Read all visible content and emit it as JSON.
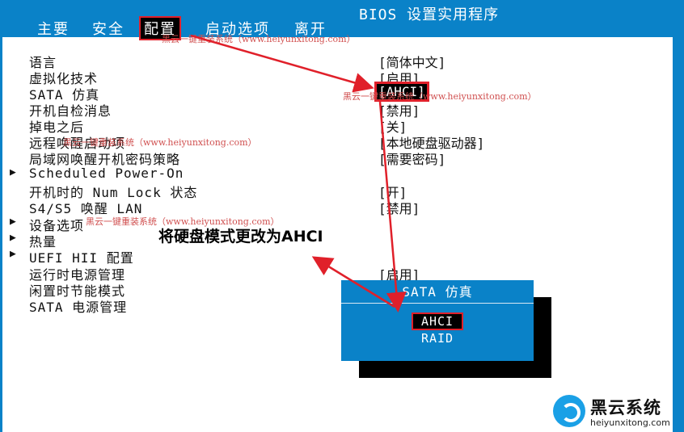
{
  "header": {
    "title": "BIOS 设置实用程序",
    "tabs": [
      {
        "label": "主要"
      },
      {
        "label": "安全"
      },
      {
        "label": "配置",
        "active": true
      },
      {
        "label": "启动选项"
      },
      {
        "label": "离开"
      }
    ]
  },
  "settings": [
    {
      "label": "语言",
      "value": "[简体中文]",
      "arrow": ""
    },
    {
      "label": "虚拟化技术",
      "value": "[启用]",
      "arrow": ""
    },
    {
      "label": "SATA 仿真",
      "value": "[AHCI]",
      "arrow": "",
      "highlight": true
    },
    {
      "label": "开机自检消息",
      "value": "[禁用]",
      "arrow": ""
    },
    {
      "label": "掉电之后",
      "value": "[关]",
      "arrow": ""
    },
    {
      "label": "远程唤醒启动项",
      "value": "[本地硬盘驱动器]",
      "arrow": ""
    },
    {
      "label": "局域网唤醒开机密码策略",
      "value": "[需要密码]",
      "arrow": ""
    },
    {
      "label": "Scheduled Power-On",
      "value": "",
      "arrow": "▶"
    },
    {
      "label": "开机时的 Num Lock 状态",
      "value": "[开]",
      "arrow": ""
    },
    {
      "label": "S4/S5 唤醒 LAN",
      "value": "[禁用]",
      "arrow": ""
    },
    {
      "label": "设备选项",
      "value": "",
      "arrow": "▶"
    },
    {
      "label": "热量",
      "value": "",
      "arrow": "▶"
    },
    {
      "label": "UEFI HII 配置",
      "value": "",
      "arrow": "▶"
    },
    {
      "label": "运行时电源管理",
      "value": "[启用]",
      "arrow": ""
    },
    {
      "label": "闲置时节能模式",
      "value": "",
      "arrow": ""
    },
    {
      "label": "SATA 电源管理",
      "value": "",
      "arrow": ""
    }
  ],
  "popup": {
    "title": "SATA 仿真",
    "options": [
      {
        "label": "AHCI",
        "selected": true
      },
      {
        "label": "RAID",
        "selected": false
      }
    ]
  },
  "annotation": "将硬盘模式更改为AHCI",
  "watermarks": [
    "黑云一键重装系统（www.heiyunxitong.com）",
    "黑云一键重装系统（www.heiyunxitong.com）",
    "黑云一键重装系统（www.heiyunxitong.com）",
    "黑云一键重装系统（www.heiyunxitong.com）"
  ],
  "logo": {
    "name": "黑云系统",
    "url": "heiyunxitong.com"
  },
  "colors": {
    "bios_blue": "#0a82c8",
    "highlight_red": "#e0202a"
  }
}
